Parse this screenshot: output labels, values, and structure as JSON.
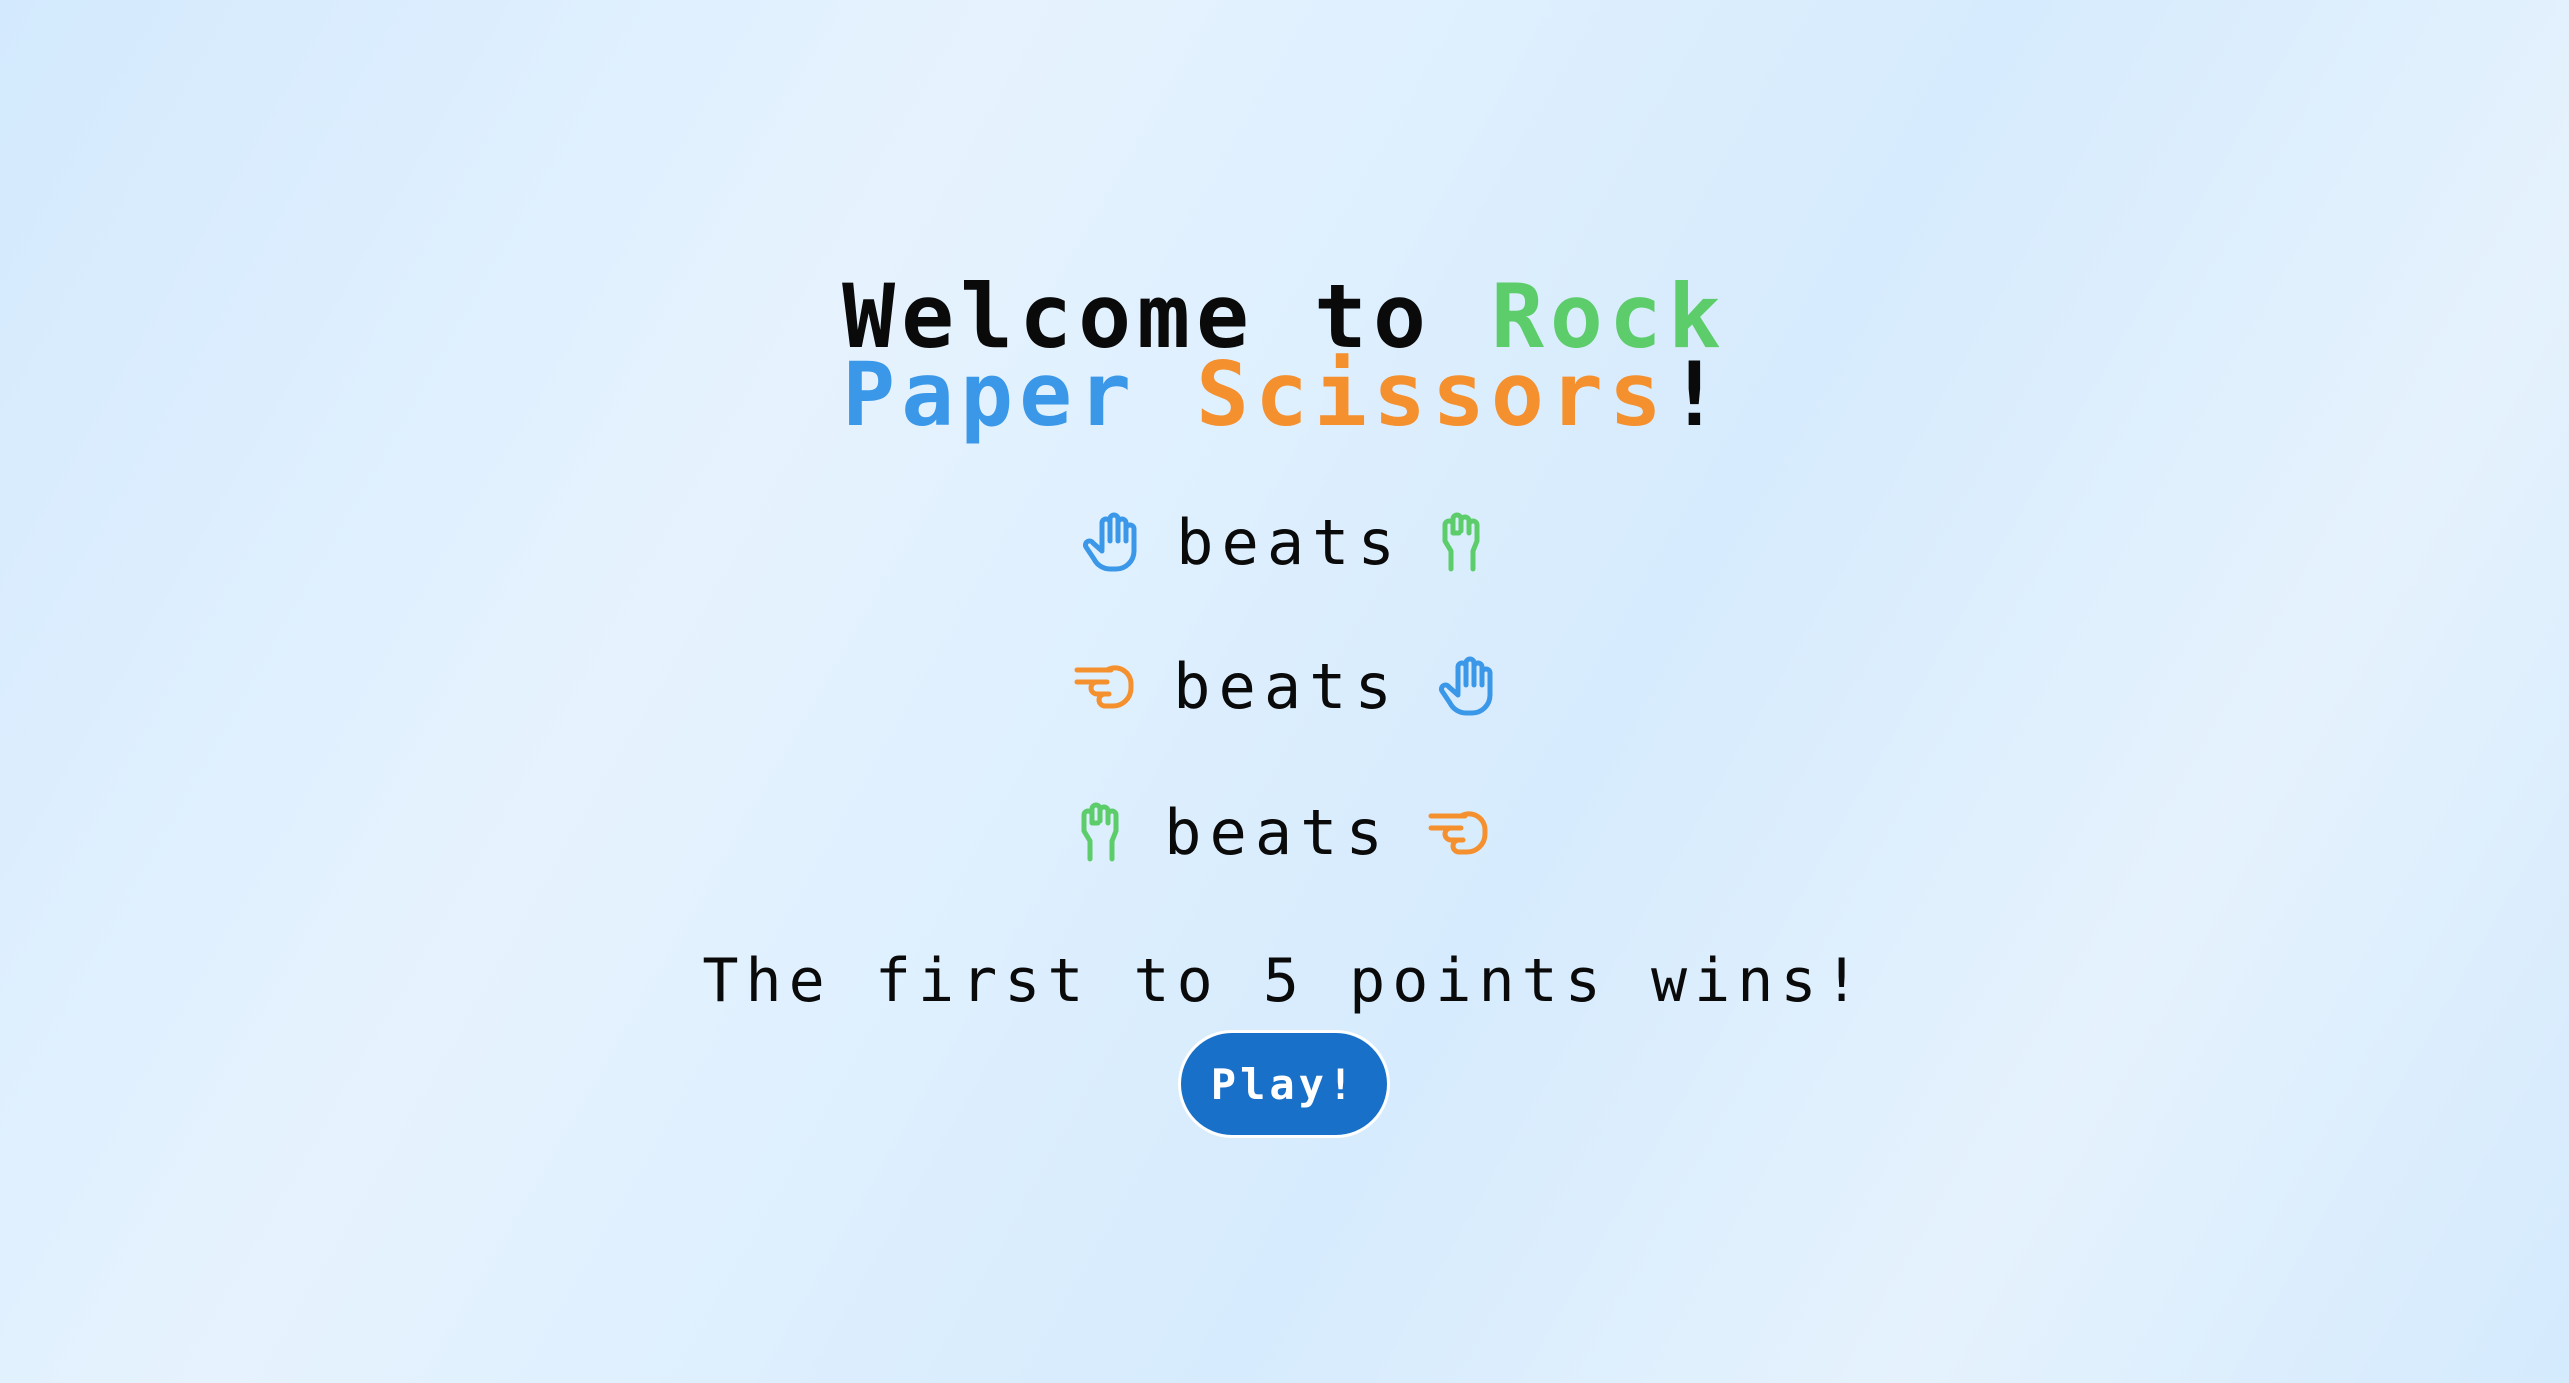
{
  "title": {
    "welcome": "Welcome to ",
    "rock": "Rock",
    "paper": "Paper",
    "scissors": "Scissors",
    "exclaim": "!"
  },
  "colors": {
    "rock": "#5ccd6a",
    "paper": "#3b98e8",
    "scissors": "#f5902e",
    "button": "#1870c8",
    "text": "#0a0a0a"
  },
  "rules": [
    {
      "winner_icon": "paper-icon",
      "word": "beats",
      "loser_icon": "rock-icon"
    },
    {
      "winner_icon": "scissors-icon",
      "word": "beats",
      "loser_icon": "paper-icon"
    },
    {
      "winner_icon": "rock-icon",
      "word": "beats",
      "loser_icon": "scissors-icon"
    }
  ],
  "win_text": "The first to 5 points wins!",
  "play_label": "Play!"
}
